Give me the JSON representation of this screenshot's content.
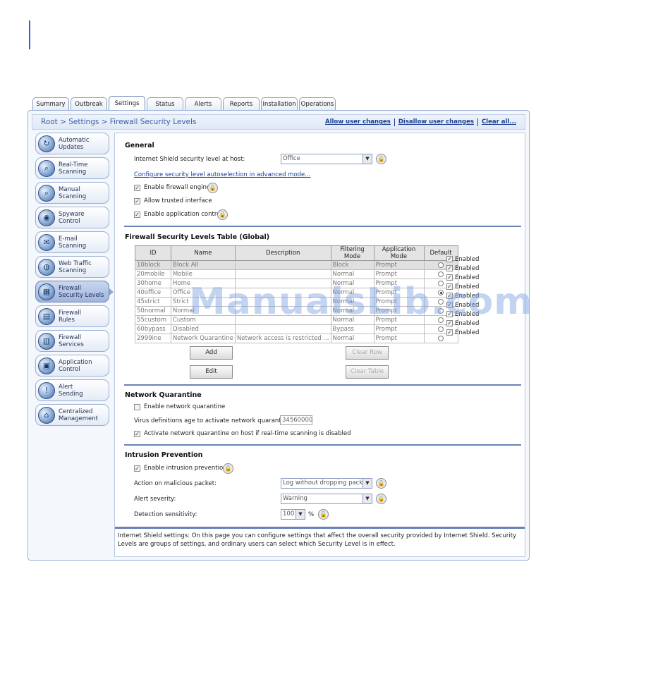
{
  "tabs": [
    "Summary",
    "Outbreak",
    "Settings",
    "Status",
    "Alerts",
    "Reports",
    "Installation",
    "Operations"
  ],
  "active_tab": "Settings",
  "breadcrumb": "Root > Settings > Firewall Security Levels",
  "header_links": {
    "allow": "Allow user changes",
    "disallow": "Disallow user changes",
    "clear": "Clear all..."
  },
  "sidebar": [
    {
      "label": "Automatic\nUpdates",
      "icon": "update-icon"
    },
    {
      "label": "Real-Time\nScanning",
      "icon": "realtime-scan-icon"
    },
    {
      "label": "Manual\nScanning",
      "icon": "manual-scan-icon"
    },
    {
      "label": "Spyware\nControl",
      "icon": "spyware-icon"
    },
    {
      "label": "E-mail\nScanning",
      "icon": "email-icon"
    },
    {
      "label": "Web Traffic\nScanning",
      "icon": "web-traffic-icon"
    },
    {
      "label": "Firewall\nSecurity Levels",
      "icon": "firewall-levels-icon",
      "active": true
    },
    {
      "label": "Firewall\nRules",
      "icon": "firewall-rules-icon"
    },
    {
      "label": "Firewall\nServices",
      "icon": "firewall-services-icon"
    },
    {
      "label": "Application\nControl",
      "icon": "application-control-icon"
    },
    {
      "label": "Alert\nSending",
      "icon": "alert-icon"
    },
    {
      "label": "Centralized\nManagement",
      "icon": "management-icon"
    }
  ],
  "general": {
    "title": "General",
    "security_level_label": "Internet Shield security level at host:",
    "security_level_value": "Office",
    "autoselect_link": "Configure security level autoselection in advanced mode...",
    "enable_firewall": "Enable firewall engine",
    "allow_trusted": "Allow trusted interface",
    "enable_app_control": "Enable application control"
  },
  "levels_table": {
    "title": "Firewall Security Levels Table (Global)",
    "headers": [
      "ID",
      "Name",
      "Description",
      "Filtering Mode",
      "Application Mode",
      "Default"
    ],
    "rows": [
      {
        "id": "10block",
        "name": "Block All",
        "desc": "",
        "filter": "Block",
        "app": "Prompt",
        "default": false,
        "enabled": "Enabled"
      },
      {
        "id": "20mobile",
        "name": "Mobile",
        "desc": "",
        "filter": "Normal",
        "app": "Prompt",
        "default": false,
        "enabled": "Enabled"
      },
      {
        "id": "30home",
        "name": "Home",
        "desc": "",
        "filter": "Normal",
        "app": "Prompt",
        "default": false,
        "enabled": "Enabled"
      },
      {
        "id": "40office",
        "name": "Office",
        "desc": "",
        "filter": "Normal",
        "app": "Prompt",
        "default": true,
        "enabled": "Enabled"
      },
      {
        "id": "45strict",
        "name": "Strict",
        "desc": "",
        "filter": "Normal",
        "app": "Prompt",
        "default": false,
        "enabled": "Enabled"
      },
      {
        "id": "50normal",
        "name": "Normal",
        "desc": "",
        "filter": "Normal",
        "app": "Prompt",
        "default": false,
        "enabled": "Enabled"
      },
      {
        "id": "55custom",
        "name": "Custom",
        "desc": "",
        "filter": "Normal",
        "app": "Prompt",
        "default": false,
        "enabled": "Enabled"
      },
      {
        "id": "60bypass",
        "name": "Disabled",
        "desc": "",
        "filter": "Bypass",
        "app": "Prompt",
        "default": false,
        "enabled": "Enabled"
      },
      {
        "id": "2999ine",
        "name": "Network Quarantine",
        "desc": "Network access is restricted ...",
        "filter": "Normal",
        "app": "Prompt",
        "default": false,
        "enabled": "Enabled"
      }
    ],
    "buttons": {
      "add": "Add",
      "edit": "Edit",
      "clear_row": "Clear Row",
      "clear_table": "Clear Table"
    }
  },
  "quarantine": {
    "title": "Network Quarantine",
    "enable": "Enable network quarantine",
    "age_label": "Virus definitions age to activate network quarantine:",
    "age_value": "34560000",
    "activate_on_disabled": "Activate network quarantine on host if real-time scanning is disabled"
  },
  "intrusion": {
    "title": "Intrusion Prevention",
    "enable": "Enable intrusion prevention",
    "action_label": "Action on malicious packet:",
    "action_value": "Log without dropping packet",
    "severity_label": "Alert severity:",
    "severity_value": "Warning",
    "sensitivity_label": "Detection sensitivity:",
    "sensitivity_value": "100",
    "sensitivity_unit": "%"
  },
  "info_text": "Internet Shield settings: On this page you can configure settings that affect the overall security provided by Internet Shield. Security Levels are groups of settings, and ordinary users can select which Security Level is in effect.",
  "watermark": "ManualsLib.com"
}
